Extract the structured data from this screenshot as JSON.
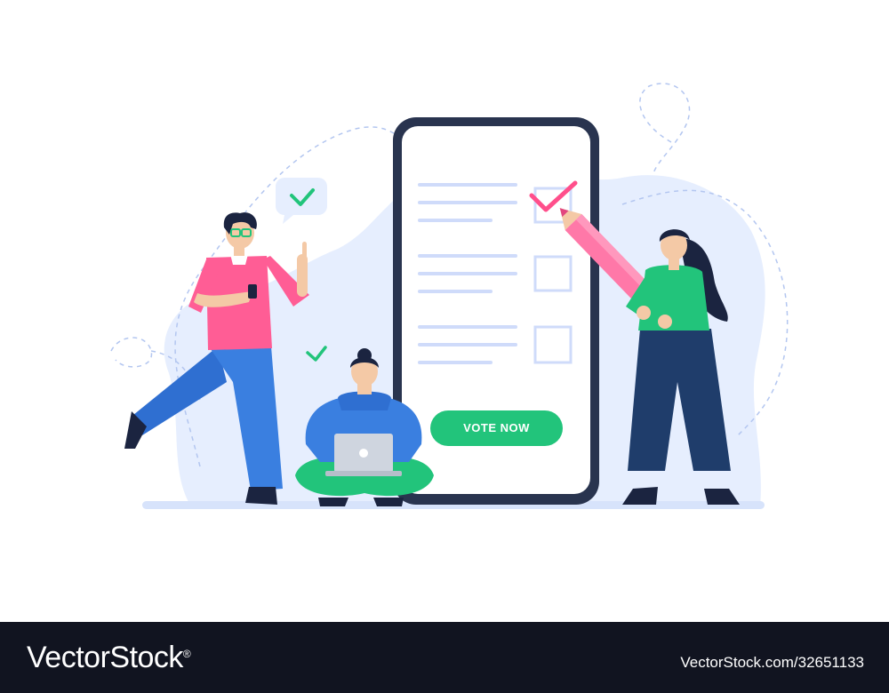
{
  "phone": {
    "vote_button_label": "VOTE NOW",
    "checklist": [
      {
        "checked": true
      },
      {
        "checked": false
      },
      {
        "checked": false
      }
    ]
  },
  "footer": {
    "brand": "VectorStock",
    "registered_mark": "®",
    "stock_id": "VectorStock.com/32651133"
  },
  "colors": {
    "accent_green": "#22c47b",
    "pink": "#ff5d95",
    "phone_frame": "#29344f",
    "blob_blue": "#e6eefe",
    "footer_bg": "#111420"
  },
  "icons": [
    "speech-bubble-check-icon",
    "laptop-apple-logo-icon",
    "pencil-icon",
    "smartphone-icon"
  ]
}
